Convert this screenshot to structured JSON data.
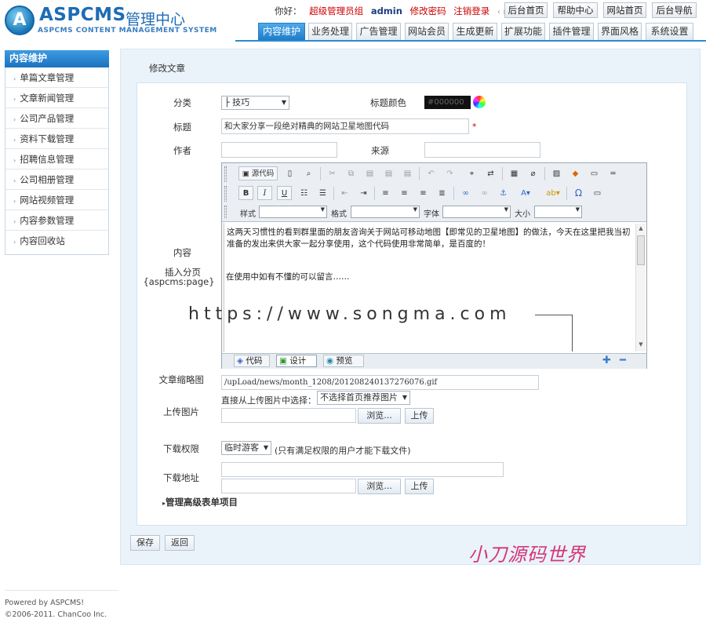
{
  "header": {
    "logo_letter": "A",
    "brand": "ASPCMS",
    "brand_cn": "管理中心",
    "brand_sub": "ASPCMS CONTENT MANAGEMENT SYSTEM",
    "greeting": "你好：",
    "role": "超级管理员组",
    "user": "admin",
    "change_pwd": "修改密码",
    "logout": "注销登录",
    "top_buttons": [
      "后台首页",
      "帮助中心",
      "网站首页",
      "后台导航"
    ],
    "tabs": [
      "内容维护",
      "业务处理",
      "广告管理",
      "网站会员",
      "生成更新",
      "扩展功能",
      "插件管理",
      "界面风格",
      "系统设置"
    ],
    "active_tab": "内容维护"
  },
  "sidebar": {
    "title": "内容维护",
    "items": [
      "单篇文章管理",
      "文章新闻管理",
      "公司产品管理",
      "资料下载管理",
      "招聘信息管理",
      "公司相册管理",
      "网站视频管理",
      "内容参数管理",
      "内容回收站"
    ]
  },
  "footer": {
    "powered": "Powered by ASPCMS!",
    "copyright": "©2006-2011. ChanCoo Inc."
  },
  "main": {
    "panel_title": "修改文章",
    "category_label": "分类",
    "category_value": "├ 技巧",
    "title_color_label": "标题颜色",
    "title_color_value": "#000000",
    "title_label": "标题",
    "title_value": "和大家分享一段绝对精典的网站卫星地图代码",
    "required_mark": "*",
    "author_label": "作者",
    "author_value": "",
    "source_label": "来源",
    "source_value": "",
    "content_label": "内容",
    "insert_page_label": "插入分页",
    "insert_page_tag": "{aspcms:page}",
    "editor": {
      "source_btn": "源代码",
      "style_label": "样式",
      "format_label": "格式",
      "font_label": "字体",
      "size_label": "大小",
      "paragraph1": "这两天习惯性的看到群里面的朋友咨询关于网站可移动地图【即常见的卫星地图】的做法，今天在这里把我当初准备的发出来供大家一起分享使用，这个代码使用非常简单，是百度的！",
      "paragraph2": "在使用中如有不懂的可以留言……",
      "mode_code": "代码",
      "mode_design": "设计",
      "mode_preview": "预览"
    },
    "watermark": "https://www.songma.com",
    "thumb_label": "文章缩略图",
    "thumb_value": "/upLoad/news/month_1208/201208240137276076.gif",
    "thumb_choose_label": "直接从上传图片中选择：",
    "thumb_choose_value": "不选择首页推荐图片",
    "upload_label": "上传图片",
    "browse_label": "浏览...",
    "upload_btn": "上传",
    "download_perm_label": "下载权限",
    "download_perm_value": "临时游客",
    "download_perm_note": "(只有满足权限的用户才能下载文件)",
    "download_url_label": "下载地址",
    "browse_label2": "浏览...",
    "upload_btn2": "上传",
    "advanced_label": "管理高级表单项目",
    "save_btn": "保存",
    "back_btn": "返回"
  },
  "brand_overlay": "小刀源码世界",
  "colors": {
    "accent": "#1f7dc9",
    "panel_bg": "#eaf3fa",
    "required": "#cc0000"
  }
}
